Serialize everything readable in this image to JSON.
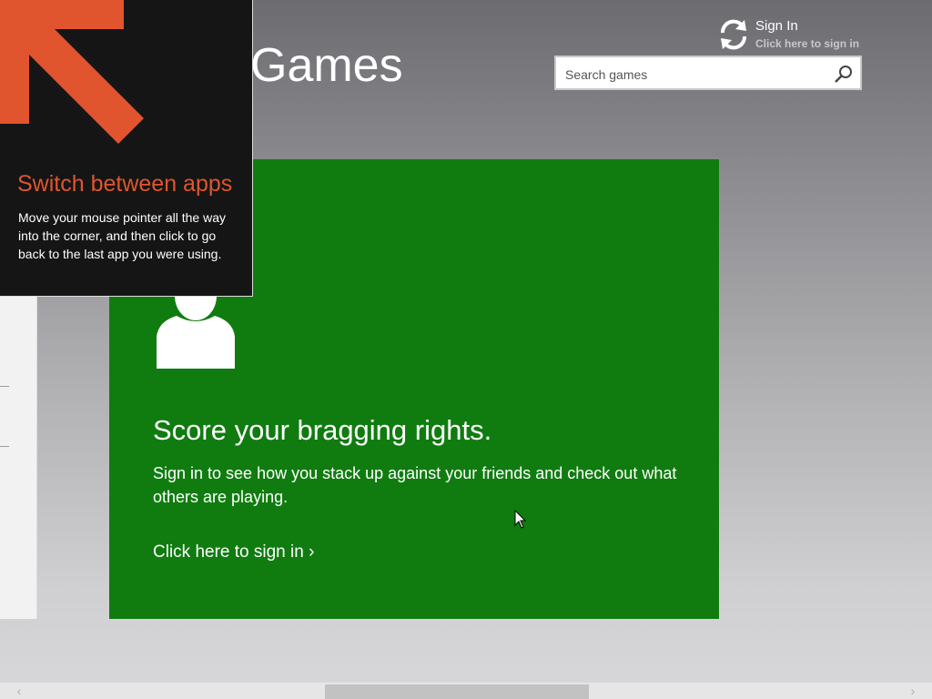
{
  "header": {
    "app_title": "Games",
    "signin_title": "Sign In",
    "signin_subtitle": "Click here to sign in",
    "signin_icon": "sync-icon"
  },
  "search": {
    "placeholder": "Search games",
    "icon": "search-icon"
  },
  "tile": {
    "heading": "Score your bragging rights.",
    "body": "Sign in to see how you stack up against your friends and check out what others are playing.",
    "link": "Click here to sign in ›",
    "color": "#107c10",
    "icon": "person-icon"
  },
  "tip": {
    "title": "Switch between apps",
    "body": "Move your mouse pointer all the way into the corner, and then click to go back to the last app you were using.",
    "accent": "#e0552e",
    "icon": "corner-arrow-icon"
  },
  "scrollbar": {
    "left_arrow": "‹",
    "right_arrow": "›"
  }
}
